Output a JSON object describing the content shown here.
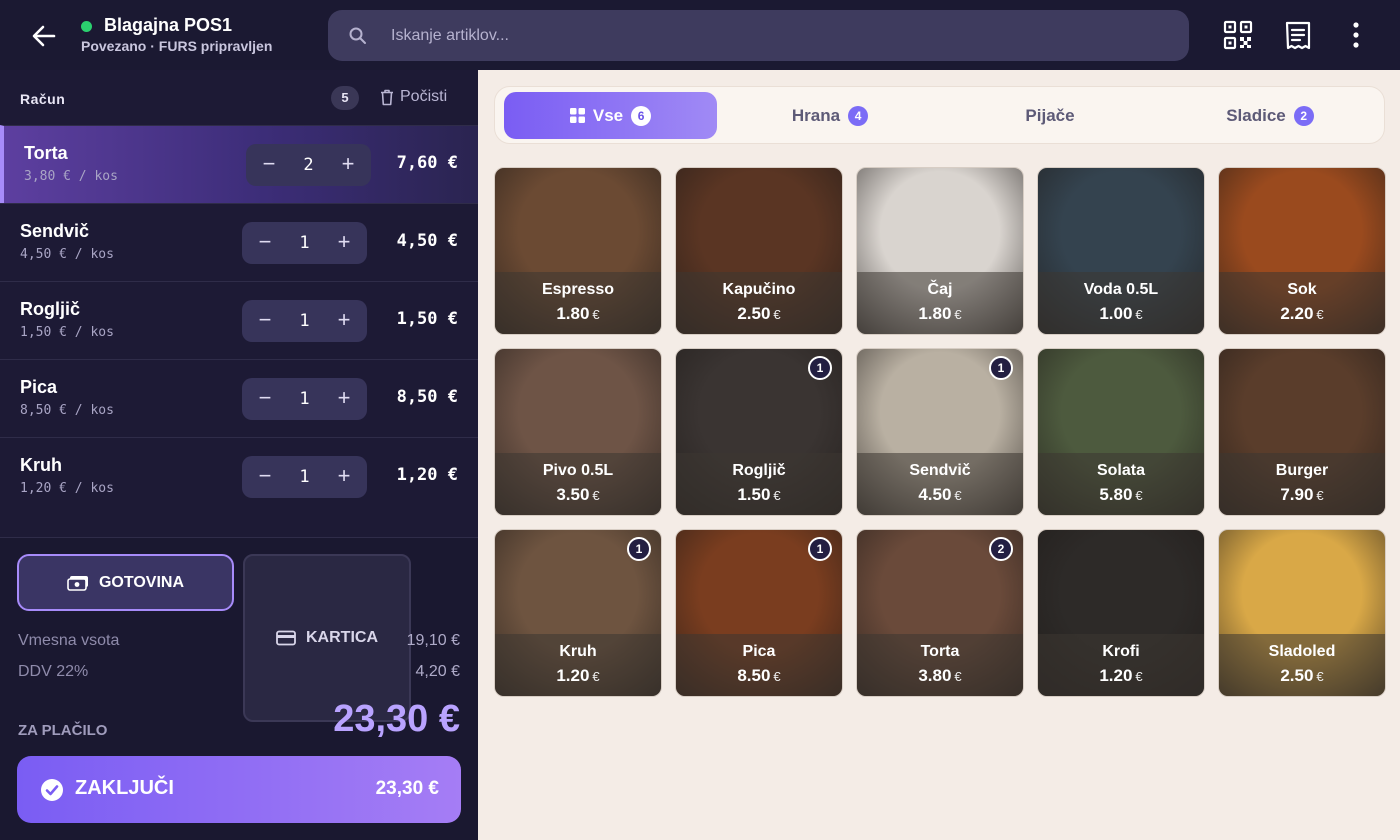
{
  "header": {
    "title": "Blagajna POS1",
    "subtitle": "Povezano · FURS pripravljen",
    "search_placeholder": "Iskanje artiklov...",
    "icons": [
      "back-arrow-icon",
      "search-icon",
      "qr-code-icon",
      "receipt-icon",
      "more-vertical-icon"
    ]
  },
  "bill": {
    "title": "Račun",
    "count": "5",
    "clear_label": "Počisti",
    "items": [
      {
        "name": "Torta",
        "unit": "3,80 € / kos",
        "qty": "2",
        "total": "7,60 €",
        "active": true
      },
      {
        "name": "Sendvič",
        "unit": "4,50 € / kos",
        "qty": "1",
        "total": "4,50 €"
      },
      {
        "name": "Rogljič",
        "unit": "1,50 € / kos",
        "qty": "1",
        "total": "1,50 €"
      },
      {
        "name": "Pica",
        "unit": "8,50 € / kos",
        "qty": "1",
        "total": "8,50 €"
      },
      {
        "name": "Kruh",
        "unit": "1,20 € / kos",
        "qty": "1",
        "total": "1,20 €"
      }
    ]
  },
  "payment": {
    "cash_label": "GOTOVINA",
    "card_label": "KARTICA",
    "subtotal_label": "Vmesna vsota",
    "subtotal_value": "19,10 €",
    "vat_label": "DDV 22%",
    "vat_value": "4,20 €",
    "due_label": "ZA PLAČILO",
    "due_value": "23,30 €",
    "finish_label": "ZAKLJUČI",
    "finish_value": "23,30 €"
  },
  "tabs": [
    {
      "label": "Vse",
      "badge": "6",
      "active": true
    },
    {
      "label": "Hrana",
      "badge": "4"
    },
    {
      "label": "Pijače",
      "badge": ""
    },
    {
      "label": "Sladice",
      "badge": "2"
    }
  ],
  "products": [
    {
      "name": "Espresso",
      "price": "1.80",
      "badge": "",
      "color": "#6b4a33"
    },
    {
      "name": "Kapučino",
      "price": "2.50",
      "badge": "",
      "color": "#5a3523"
    },
    {
      "name": "Čaj",
      "price": "1.80",
      "badge": "",
      "color": "#d9d4cf"
    },
    {
      "name": "Voda 0.5L",
      "price": "1.00",
      "badge": "",
      "color": "#34434f"
    },
    {
      "name": "Sok",
      "price": "2.20",
      "badge": "",
      "color": "#9a4a1e"
    },
    {
      "name": "Pivo 0.5L",
      "price": "3.50",
      "badge": "",
      "color": "#6e5446"
    },
    {
      "name": "Rogljič",
      "price": "1.50",
      "badge": "1",
      "color": "#3a3432"
    },
    {
      "name": "Sendvič",
      "price": "4.50",
      "badge": "1",
      "color": "#b9b0a2"
    },
    {
      "name": "Solata",
      "price": "5.80",
      "badge": "",
      "color": "#4d5a3e"
    },
    {
      "name": "Burger",
      "price": "7.90",
      "badge": "",
      "color": "#5a3d2b"
    },
    {
      "name": "Kruh",
      "price": "1.20",
      "badge": "1",
      "color": "#6e5440"
    },
    {
      "name": "Pica",
      "price": "8.50",
      "badge": "1",
      "color": "#7a3d1f"
    },
    {
      "name": "Torta",
      "price": "3.80",
      "badge": "2",
      "color": "#6a4a3a"
    },
    {
      "name": "Krofi",
      "price": "1.20",
      "badge": "",
      "color": "#2d2a28"
    },
    {
      "name": "Sladoled",
      "price": "2.50",
      "badge": "",
      "color": "#d9a847"
    }
  ],
  "currency_symbol": "€"
}
